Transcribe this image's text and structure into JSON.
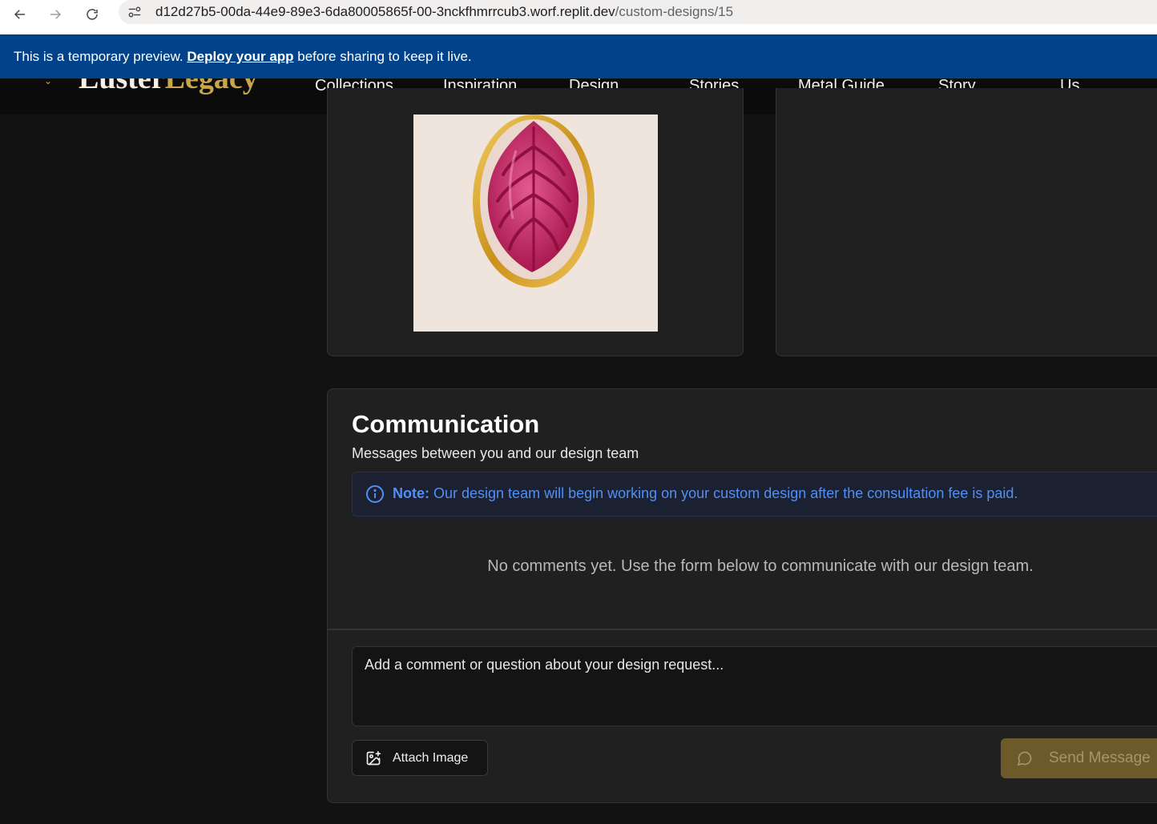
{
  "browser": {
    "url_host": "d12d27b5-00da-44e9-89e3-6da80005865f-00-3nckfhmrrcub3.worf.replit.dev",
    "url_path": "/custom-designs/15"
  },
  "banner": {
    "text_before": "This is a temporary preview. ",
    "link_label": "Deploy your app",
    "text_after": " before sharing to keep it live."
  },
  "header": {
    "logo_part1": "Luster",
    "logo_part2": "Legacy",
    "nav": [
      "Collections",
      "Inspiration",
      "Design",
      "Stories",
      "Metal Guide",
      "Story",
      "Us"
    ]
  },
  "communication": {
    "title": "Communication",
    "subtitle": "Messages between you and our design team",
    "note_label": "Note:",
    "note_text": " Our design team will begin working on your custom design after the consultation fee is paid.",
    "empty_message": "No comments yet. Use the form below to communicate with our design team.",
    "comment_placeholder": "Add a comment or question about your design request...",
    "attach_label": "Attach Image",
    "send_label": "Send Message"
  },
  "colors": {
    "banner_bg": "#00438a",
    "accent_gold": "#c9a54b",
    "note_blue": "#4f8ff7",
    "card_bg": "#202020",
    "page_bg": "#121212"
  }
}
